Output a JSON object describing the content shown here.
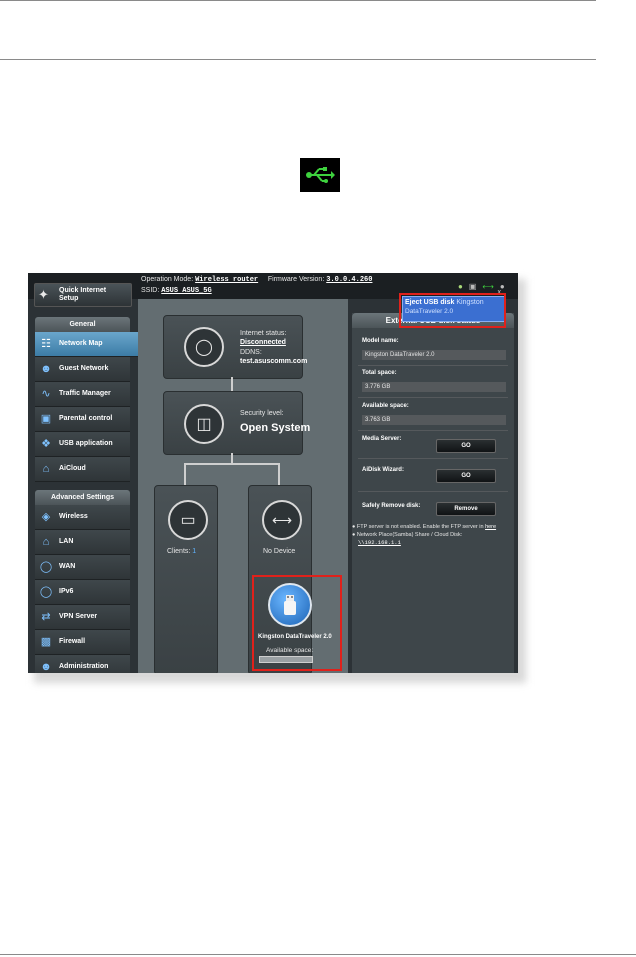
{
  "router": {
    "operation_mode_label": "Operation Mode:",
    "operation_mode_value": "Wireless router",
    "firmware_label": "Firmware Version:",
    "firmware_value": "3.0.0.4.260",
    "ssid_label": "SSID:",
    "ssid_values": "ASUS  ASUS_5G"
  },
  "sidebar": {
    "quick_setup": "Quick Internet Setup",
    "general_header": "General",
    "general_items": [
      {
        "label": "Network Map"
      },
      {
        "label": "Guest Network"
      },
      {
        "label": "Traffic Manager"
      },
      {
        "label": "Parental control"
      },
      {
        "label": "USB application"
      },
      {
        "label": "AiCloud"
      }
    ],
    "advanced_header": "Advanced Settings",
    "advanced_items": [
      {
        "label": "Wireless"
      },
      {
        "label": "LAN"
      },
      {
        "label": "WAN"
      },
      {
        "label": "IPv6"
      },
      {
        "label": "VPN Server"
      },
      {
        "label": "Firewall"
      },
      {
        "label": "Administration"
      }
    ]
  },
  "map": {
    "internet_status_label": "Internet status:",
    "internet_status_value": "Disconnected",
    "ddns_label": "DDNS:",
    "ddns_value": "test.asuscomm.com",
    "security_label": "Security level:",
    "security_value": "Open System",
    "clients_label": "Clients:",
    "clients_count": "1",
    "no_device": "No Device",
    "usb_device_name": "Kingston DataTraveler 2.0",
    "available_space_label": "Available space:"
  },
  "usb_panel": {
    "title": "External USB disk status",
    "model_label": "Model name:",
    "model_value": "Kingston DataTraveler 2.0",
    "total_label": "Total space:",
    "total_value": "3.776 GB",
    "available_label": "Available space:",
    "available_value": "3.763 GB",
    "media_server_label": "Media Server:",
    "aidisk_label": "AiDisk Wizard:",
    "go_label": "GO",
    "safely_remove_label": "Safely Remove disk:",
    "remove_label": "Remove",
    "note1_text": "FTP server is not enabled. Enable the FTP server in",
    "note1_link": "here",
    "note2_text": "Network Place(Samba) Share / Cloud Disk:",
    "note2_link": "\\\\192.168.1.1"
  },
  "eject_popup": {
    "line1_bold": "Eject USB disk",
    "line1_rest": "Kingston",
    "line2": "DataTraveler 2.0",
    "close": "x"
  },
  "colors": {
    "highlight": "#e0211b",
    "usb_icon": "#3ed23e",
    "active_menu": "#4a8ab5"
  }
}
